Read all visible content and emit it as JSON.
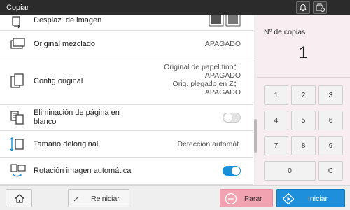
{
  "header": {
    "title": "Copiar",
    "icons": [
      "bell-icon",
      "device-status-icon"
    ]
  },
  "list": {
    "rows": [
      {
        "label": "Desplaz. de imagen",
        "icon": "image-shift-icon",
        "value_icon": "image-shift-preview-icon"
      },
      {
        "label": "Original mezclado",
        "icon": "mixed-original-icon",
        "value": "APAGADO"
      },
      {
        "label": "Config.original",
        "icon": "original-settings-icon",
        "value_lines": [
          "Original de papel fino：",
          "APAGADO",
          "Orig. plegado en Z：",
          "APAGADO"
        ]
      },
      {
        "label_lines": [
          "Eliminación de página en",
          "blanco"
        ],
        "icon": "blank-page-removal-icon",
        "toggle": false
      },
      {
        "label": "Tamaño deloriginal",
        "icon": "original-size-icon",
        "value": "Detección automát."
      },
      {
        "label": "Rotación imagen automática",
        "icon": "auto-rotate-icon",
        "toggle": true
      }
    ]
  },
  "panel": {
    "copies_label": "Nº de copias",
    "copies_value": "1",
    "keys": [
      "1",
      "2",
      "3",
      "4",
      "5",
      "6",
      "7",
      "8",
      "9",
      "0",
      "C"
    ]
  },
  "footer": {
    "home_icon": "home-icon",
    "reset_label": "Reiniciar",
    "stop_label": "Parar",
    "start_label": "Iniciar"
  },
  "colors": {
    "header_bg": "#2b2b2b",
    "panel_bg": "#f8eef1",
    "stop_bg": "#f2a3b2",
    "start_bg": "#1e8fdb",
    "toggle_on": "#1a8fd9"
  }
}
